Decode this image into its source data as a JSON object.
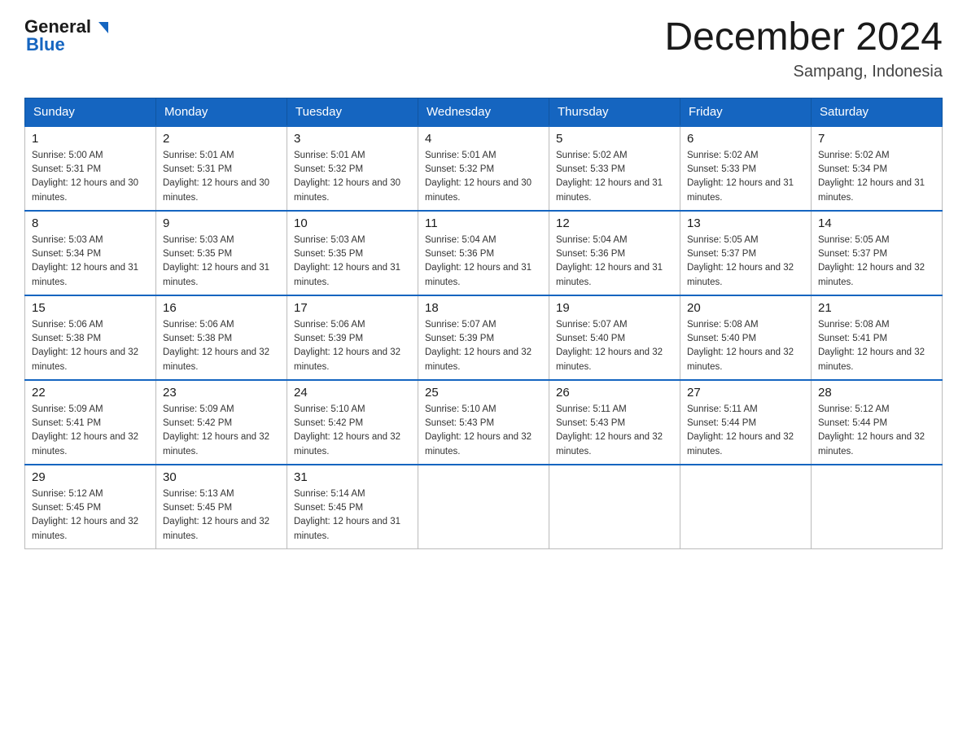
{
  "header": {
    "logo": {
      "general": "General",
      "blue": "Blue"
    },
    "title": "December 2024",
    "location": "Sampang, Indonesia"
  },
  "days_of_week": [
    "Sunday",
    "Monday",
    "Tuesday",
    "Wednesday",
    "Thursday",
    "Friday",
    "Saturday"
  ],
  "weeks": [
    [
      {
        "num": "1",
        "sunrise": "5:00 AM",
        "sunset": "5:31 PM",
        "daylight": "12 hours and 30 minutes."
      },
      {
        "num": "2",
        "sunrise": "5:01 AM",
        "sunset": "5:31 PM",
        "daylight": "12 hours and 30 minutes."
      },
      {
        "num": "3",
        "sunrise": "5:01 AM",
        "sunset": "5:32 PM",
        "daylight": "12 hours and 30 minutes."
      },
      {
        "num": "4",
        "sunrise": "5:01 AM",
        "sunset": "5:32 PM",
        "daylight": "12 hours and 30 minutes."
      },
      {
        "num": "5",
        "sunrise": "5:02 AM",
        "sunset": "5:33 PM",
        "daylight": "12 hours and 31 minutes."
      },
      {
        "num": "6",
        "sunrise": "5:02 AM",
        "sunset": "5:33 PM",
        "daylight": "12 hours and 31 minutes."
      },
      {
        "num": "7",
        "sunrise": "5:02 AM",
        "sunset": "5:34 PM",
        "daylight": "12 hours and 31 minutes."
      }
    ],
    [
      {
        "num": "8",
        "sunrise": "5:03 AM",
        "sunset": "5:34 PM",
        "daylight": "12 hours and 31 minutes."
      },
      {
        "num": "9",
        "sunrise": "5:03 AM",
        "sunset": "5:35 PM",
        "daylight": "12 hours and 31 minutes."
      },
      {
        "num": "10",
        "sunrise": "5:03 AM",
        "sunset": "5:35 PM",
        "daylight": "12 hours and 31 minutes."
      },
      {
        "num": "11",
        "sunrise": "5:04 AM",
        "sunset": "5:36 PM",
        "daylight": "12 hours and 31 minutes."
      },
      {
        "num": "12",
        "sunrise": "5:04 AM",
        "sunset": "5:36 PM",
        "daylight": "12 hours and 31 minutes."
      },
      {
        "num": "13",
        "sunrise": "5:05 AM",
        "sunset": "5:37 PM",
        "daylight": "12 hours and 32 minutes."
      },
      {
        "num": "14",
        "sunrise": "5:05 AM",
        "sunset": "5:37 PM",
        "daylight": "12 hours and 32 minutes."
      }
    ],
    [
      {
        "num": "15",
        "sunrise": "5:06 AM",
        "sunset": "5:38 PM",
        "daylight": "12 hours and 32 minutes."
      },
      {
        "num": "16",
        "sunrise": "5:06 AM",
        "sunset": "5:38 PM",
        "daylight": "12 hours and 32 minutes."
      },
      {
        "num": "17",
        "sunrise": "5:06 AM",
        "sunset": "5:39 PM",
        "daylight": "12 hours and 32 minutes."
      },
      {
        "num": "18",
        "sunrise": "5:07 AM",
        "sunset": "5:39 PM",
        "daylight": "12 hours and 32 minutes."
      },
      {
        "num": "19",
        "sunrise": "5:07 AM",
        "sunset": "5:40 PM",
        "daylight": "12 hours and 32 minutes."
      },
      {
        "num": "20",
        "sunrise": "5:08 AM",
        "sunset": "5:40 PM",
        "daylight": "12 hours and 32 minutes."
      },
      {
        "num": "21",
        "sunrise": "5:08 AM",
        "sunset": "5:41 PM",
        "daylight": "12 hours and 32 minutes."
      }
    ],
    [
      {
        "num": "22",
        "sunrise": "5:09 AM",
        "sunset": "5:41 PM",
        "daylight": "12 hours and 32 minutes."
      },
      {
        "num": "23",
        "sunrise": "5:09 AM",
        "sunset": "5:42 PM",
        "daylight": "12 hours and 32 minutes."
      },
      {
        "num": "24",
        "sunrise": "5:10 AM",
        "sunset": "5:42 PM",
        "daylight": "12 hours and 32 minutes."
      },
      {
        "num": "25",
        "sunrise": "5:10 AM",
        "sunset": "5:43 PM",
        "daylight": "12 hours and 32 minutes."
      },
      {
        "num": "26",
        "sunrise": "5:11 AM",
        "sunset": "5:43 PM",
        "daylight": "12 hours and 32 minutes."
      },
      {
        "num": "27",
        "sunrise": "5:11 AM",
        "sunset": "5:44 PM",
        "daylight": "12 hours and 32 minutes."
      },
      {
        "num": "28",
        "sunrise": "5:12 AM",
        "sunset": "5:44 PM",
        "daylight": "12 hours and 32 minutes."
      }
    ],
    [
      {
        "num": "29",
        "sunrise": "5:12 AM",
        "sunset": "5:45 PM",
        "daylight": "12 hours and 32 minutes."
      },
      {
        "num": "30",
        "sunrise": "5:13 AM",
        "sunset": "5:45 PM",
        "daylight": "12 hours and 32 minutes."
      },
      {
        "num": "31",
        "sunrise": "5:14 AM",
        "sunset": "5:45 PM",
        "daylight": "12 hours and 31 minutes."
      },
      null,
      null,
      null,
      null
    ]
  ],
  "labels": {
    "sunrise": "Sunrise:",
    "sunset": "Sunset:",
    "daylight": "Daylight:"
  }
}
